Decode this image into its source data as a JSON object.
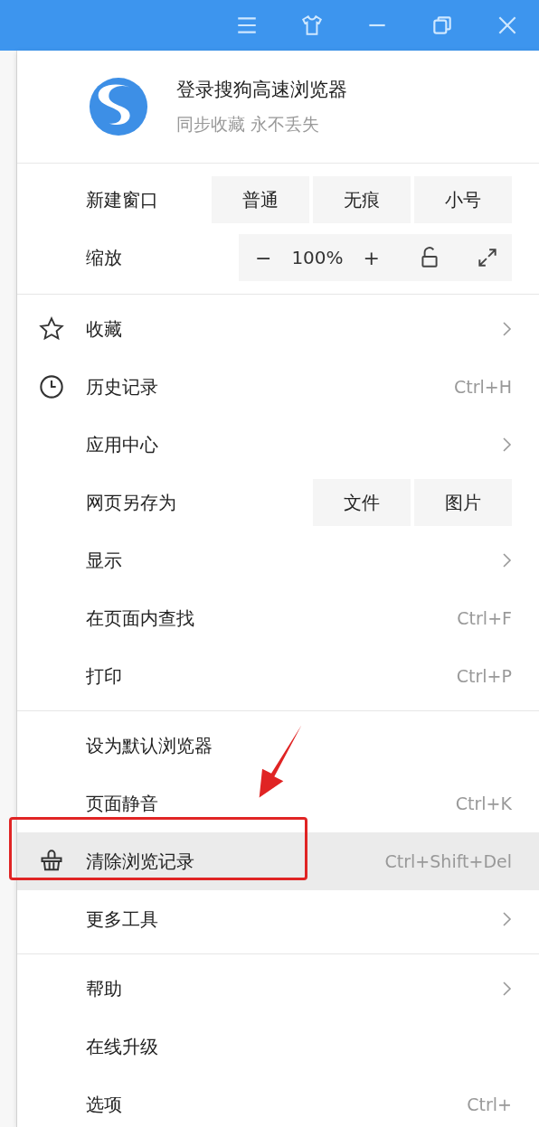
{
  "account": {
    "title": "登录搜狗高速浏览器",
    "subtitle": "同步收藏 永不丢失"
  },
  "new_window": {
    "label": "新建窗口",
    "buttons": [
      "普通",
      "无痕",
      "小号"
    ]
  },
  "zoom": {
    "label": "缩放",
    "minus": "−",
    "value": "100%",
    "plus": "+"
  },
  "sections": [
    [
      {
        "kind": "submenu",
        "label": "收藏",
        "highlighted": false
      },
      {
        "kind": "shortcut",
        "label": "历史记录",
        "shortcut": "Ctrl+H",
        "highlighted": false
      },
      {
        "kind": "submenu",
        "label": "应用中心",
        "highlighted": false
      },
      {
        "kind": "buttons",
        "label": "网页另存为",
        "buttons": [
          "文件",
          "图片"
        ],
        "highlighted": false
      },
      {
        "kind": "submenu",
        "label": "显示",
        "highlighted": false
      },
      {
        "kind": "shortcut",
        "label": "在页面内查找",
        "shortcut": "Ctrl+F",
        "highlighted": false
      },
      {
        "kind": "shortcut",
        "label": "打印",
        "shortcut": "Ctrl+P",
        "highlighted": false
      }
    ],
    [
      {
        "kind": "plain",
        "label": "设为默认浏览器",
        "highlighted": false
      },
      {
        "kind": "shortcut",
        "label": "页面静音",
        "shortcut": "Ctrl+K",
        "highlighted": false
      },
      {
        "kind": "shortcut",
        "label": "清除浏览记录",
        "shortcut": "Ctrl+Shift+Del",
        "highlighted": true
      },
      {
        "kind": "submenu",
        "label": "更多工具",
        "highlighted": false
      }
    ],
    [
      {
        "kind": "submenu",
        "label": "帮助",
        "highlighted": false
      },
      {
        "kind": "plain",
        "label": "在线升级",
        "highlighted": false
      },
      {
        "kind": "shortcut",
        "label": "选项",
        "shortcut": "Ctrl+",
        "highlighted": false
      }
    ]
  ]
}
